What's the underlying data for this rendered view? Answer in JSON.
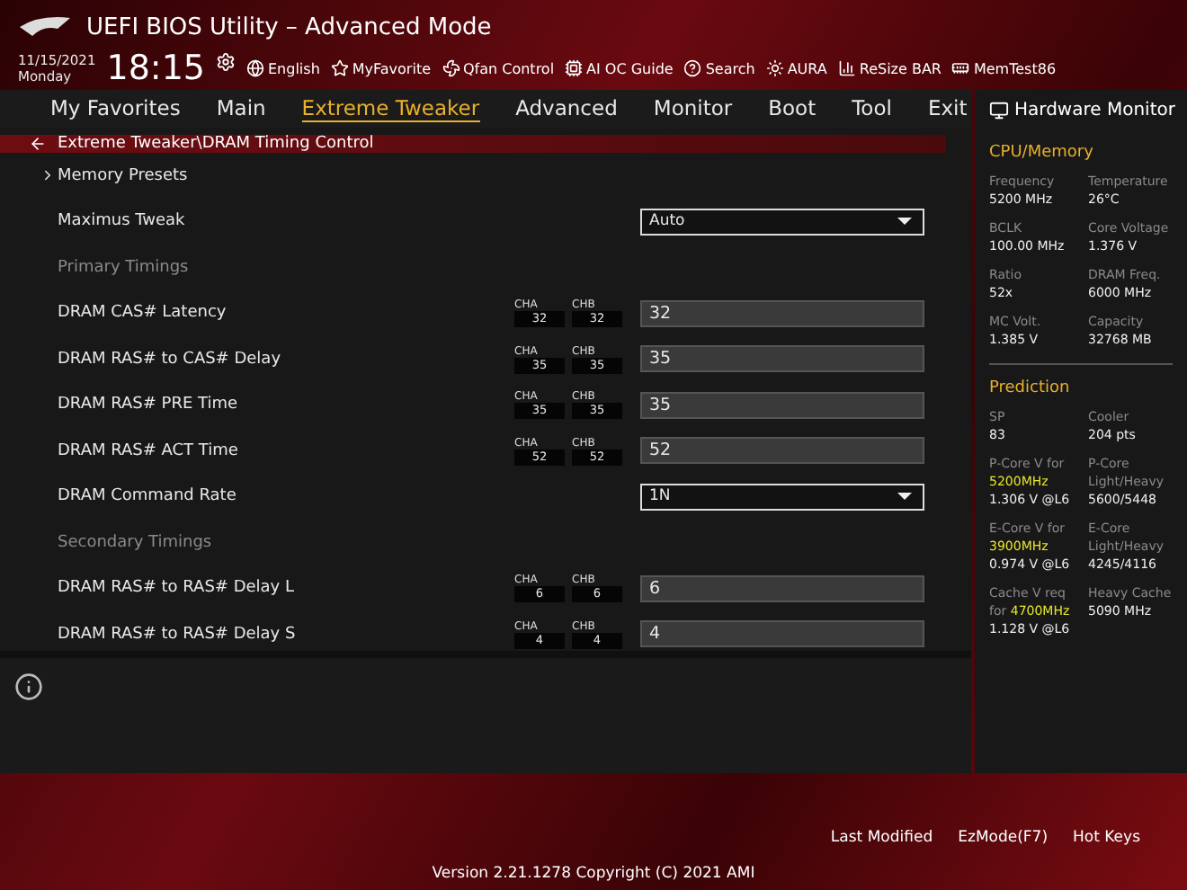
{
  "header": {
    "title": "UEFI BIOS Utility – Advanced Mode",
    "date": "11/15/2021",
    "day": "Monday",
    "time": "18:15",
    "tools": [
      {
        "kind": "globe",
        "label": "English"
      },
      {
        "kind": "fav",
        "label": "MyFavorite"
      },
      {
        "kind": "fan",
        "label": "Qfan Control"
      },
      {
        "kind": "chip",
        "label": "AI OC Guide"
      },
      {
        "kind": "help",
        "label": "Search"
      },
      {
        "kind": "light",
        "label": "AURA"
      },
      {
        "kind": "bar",
        "label": "ReSize BAR"
      },
      {
        "kind": "mem",
        "label": "MemTest86"
      }
    ]
  },
  "tabs": [
    {
      "label": "My Favorites",
      "selected": false
    },
    {
      "label": "Main",
      "selected": false
    },
    {
      "label": "Extreme Tweaker",
      "selected": true
    },
    {
      "label": "Advanced",
      "selected": false
    },
    {
      "label": "Monitor",
      "selected": false
    },
    {
      "label": "Boot",
      "selected": false
    },
    {
      "label": "Tool",
      "selected": false
    },
    {
      "label": "Exit",
      "selected": false
    }
  ],
  "breadcrumb": "Extreme Tweaker\\DRAM Timing Control",
  "rows": [
    {
      "kind": "link",
      "label": "Memory Presets"
    },
    {
      "kind": "select",
      "label": "Maximus Tweak",
      "value": "Auto"
    },
    {
      "kind": "heading",
      "label": "Primary Timings"
    },
    {
      "kind": "timing",
      "label": "DRAM CAS# Latency",
      "channels": [
        {
          "label": "CHA",
          "value": "32"
        },
        {
          "label": "CHB",
          "value": "32"
        }
      ],
      "value": "32"
    },
    {
      "kind": "timing",
      "label": "DRAM RAS# to CAS# Delay",
      "channels": [
        {
          "label": "CHA",
          "value": "35"
        },
        {
          "label": "CHB",
          "value": "35"
        }
      ],
      "value": "35"
    },
    {
      "kind": "timing",
      "label": "DRAM RAS# PRE Time",
      "channels": [
        {
          "label": "CHA",
          "value": "35"
        },
        {
          "label": "CHB",
          "value": "35"
        }
      ],
      "value": "35"
    },
    {
      "kind": "timing",
      "label": "DRAM RAS# ACT Time",
      "channels": [
        {
          "label": "CHA",
          "value": "52"
        },
        {
          "label": "CHB",
          "value": "52"
        }
      ],
      "value": "52"
    },
    {
      "kind": "select",
      "label": "DRAM Command Rate",
      "value": "1N"
    },
    {
      "kind": "heading",
      "label": "Secondary Timings"
    },
    {
      "kind": "timing",
      "label": "DRAM RAS# to RAS# Delay L",
      "channels": [
        {
          "label": "CHA",
          "value": "6"
        },
        {
          "label": "CHB",
          "value": "6"
        }
      ],
      "value": "6"
    },
    {
      "kind": "timing",
      "label": "DRAM RAS# to RAS# Delay S",
      "channels": [
        {
          "label": "CHA",
          "value": "4"
        },
        {
          "label": "CHB",
          "value": "4"
        }
      ],
      "value": "4"
    }
  ],
  "hardware_monitor": {
    "title": "Hardware Monitor",
    "cpu_memory": {
      "title": "CPU/Memory",
      "items": [
        {
          "label": "Frequency",
          "value": "5200 MHz"
        },
        {
          "label": "Temperature",
          "value": "26°C"
        },
        {
          "label": "BCLK",
          "value": "100.00 MHz"
        },
        {
          "label": "Core Voltage",
          "value": "1.376 V"
        },
        {
          "label": "Ratio",
          "value": "52x"
        },
        {
          "label": "DRAM Freq.",
          "value": "6000 MHz"
        },
        {
          "label": "MC Volt.",
          "value": "1.385 V"
        },
        {
          "label": "Capacity",
          "value": "32768 MB"
        }
      ]
    },
    "prediction": {
      "title": "Prediction",
      "items": [
        {
          "label": "SP",
          "value": "83"
        },
        {
          "label": "Cooler",
          "value": "204 pts"
        },
        {
          "label": "P-Core V for",
          "highlight": "5200MHz",
          "value": "1.306 V @L6"
        },
        {
          "label": "P-Core",
          "label2": "Light/Heavy",
          "value": "5600/5448"
        },
        {
          "label": "E-Core V for",
          "highlight": "3900MHz",
          "value": "0.974 V @L6"
        },
        {
          "label": "E-Core",
          "label2": "Light/Heavy",
          "value": "4245/4116"
        },
        {
          "label": "Cache V req",
          "label2": "for",
          "highlight": "4700MHz",
          "value": "1.128 V @L6"
        },
        {
          "label": "Heavy Cache",
          "value": "5090 MHz"
        }
      ]
    }
  },
  "footer": {
    "version": "Version 2.21.1278 Copyright (C) 2021 AMI",
    "actions": [
      "Last Modified",
      "EzMode(F7)",
      "Hot Keys"
    ]
  }
}
